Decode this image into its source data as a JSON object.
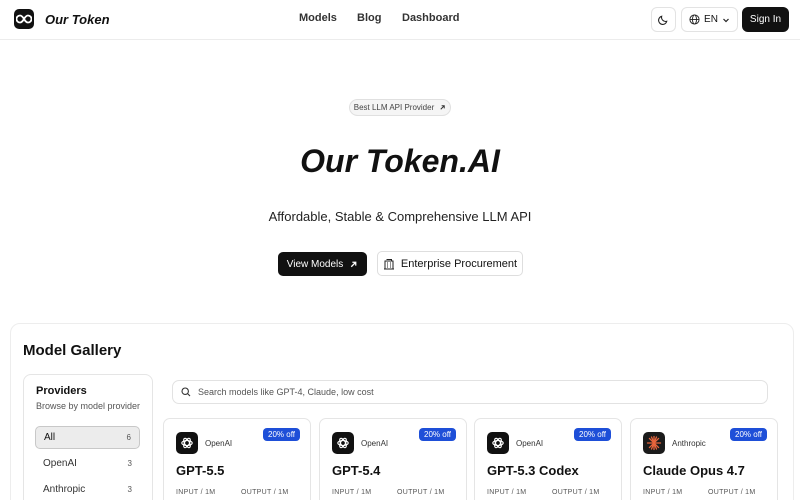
{
  "header": {
    "brand": "Our Token",
    "nav": [
      "Models",
      "Blog",
      "Dashboard"
    ],
    "language": "EN",
    "signin": "Sign In"
  },
  "hero": {
    "pill": "Best LLM API Provider",
    "title": "Our Token.AI",
    "subtitle": "Affordable, Stable & Comprehensive LLM API",
    "primary_button": "View Models",
    "secondary_button": "Enterprise Procurement"
  },
  "gallery": {
    "title": "Model Gallery",
    "providers_title": "Providers",
    "providers_subtitle": "Browse by model provider",
    "providers": [
      {
        "label": "All",
        "count": "6"
      },
      {
        "label": "OpenAI",
        "count": "3"
      },
      {
        "label": "Anthropic",
        "count": "3"
      }
    ],
    "search_placeholder": "Search models like GPT-4, Claude, low cost",
    "cards": [
      {
        "provider": "OpenAI",
        "badge": "20% off",
        "name": "GPT-5.5",
        "input_label": "INPUT / 1M",
        "output_label": "OUTPUT / 1M"
      },
      {
        "provider": "OpenAI",
        "badge": "20% off",
        "name": "GPT-5.4",
        "input_label": "INPUT / 1M",
        "output_label": "OUTPUT / 1M"
      },
      {
        "provider": "OpenAI",
        "badge": "20% off",
        "name": "GPT-5.3 Codex",
        "input_label": "INPUT / 1M",
        "output_label": "OUTPUT / 1M"
      },
      {
        "provider": "Anthropic",
        "badge": "20% off",
        "name": "Claude Opus 4.7",
        "input_label": "INPUT / 1M",
        "output_label": "OUTPUT / 1M"
      }
    ]
  },
  "colors": {
    "accent": "#111111",
    "badge": "#1e4fd8",
    "anthropic_icon": "#e8653c"
  }
}
